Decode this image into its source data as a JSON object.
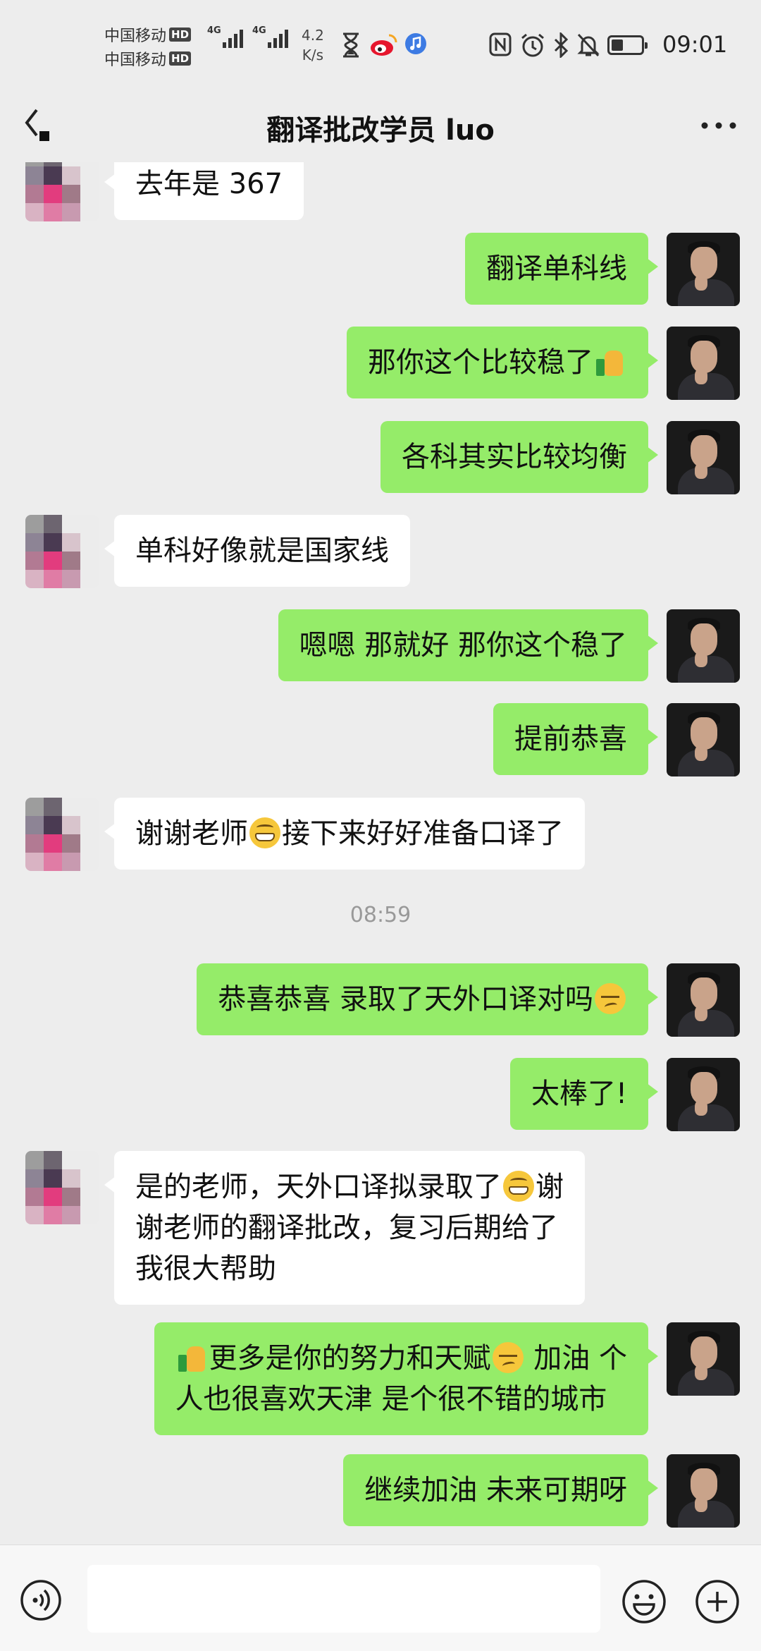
{
  "status_bar": {
    "carrier1": "中国移动",
    "carrier2": "中国移动",
    "hd": "HD",
    "network": "4G",
    "speed_value": "4.2",
    "speed_unit": "K/s",
    "time": "09:01",
    "icons": [
      "hourglass-icon",
      "weibo-icon",
      "music-icon",
      "nfc-icon",
      "alarm-icon",
      "bluetooth-icon",
      "mute-icon",
      "battery-icon"
    ]
  },
  "header": {
    "title": "翻译批改学员 luo",
    "back_icon": "back-arrow-icon",
    "more_icon": "more-icon"
  },
  "messages": [
    {
      "from": "other",
      "text": "去年是 367"
    },
    {
      "from": "me",
      "text": "翻译单科线"
    },
    {
      "from": "me",
      "text": "那你这个比较稳了",
      "emoji_after": "thumbs-up"
    },
    {
      "from": "me",
      "text": "各科其实比较均衡"
    },
    {
      "from": "other",
      "text": "单科好像就是国家线"
    },
    {
      "from": "me",
      "text": "嗯嗯 那就好 那你这个稳了"
    },
    {
      "from": "me",
      "text": "提前恭喜"
    },
    {
      "from": "other",
      "text_a": "谢谢老师",
      "emoji": "grin",
      "text_b": "接下来好好准备口译了"
    },
    {
      "timestamp": "08:59"
    },
    {
      "from": "me",
      "text": "恭喜恭喜 录取了天外口译对吗",
      "emoji_after": "smirk"
    },
    {
      "from": "me",
      "text": "太棒了!"
    },
    {
      "from": "other",
      "line1_a": "是的老师，天外口译拟录取了",
      "emoji": "grin",
      "line1_b": "谢",
      "line2": "谢老师的翻译批改，复习后期给了",
      "line3": "我很大帮助"
    },
    {
      "from": "me",
      "emoji_before": "thumbs-up",
      "line1_a": "更多是你的努力和天赋",
      "emoji": "smirk",
      "line1_b": " 加油 个",
      "line2": "人也很喜欢天津  是个很不错的城市"
    },
    {
      "from": "me",
      "text": "继续加油 未来可期呀"
    }
  ],
  "input_bar": {
    "value": "",
    "voice_icon": "voice-icon",
    "emoji_icon": "emoji-icon",
    "plus_icon": "plus-icon"
  },
  "colors": {
    "background": "#ededed",
    "my_bubble": "#95ec69",
    "other_bubble": "#ffffff",
    "timestamp": "#999999"
  }
}
